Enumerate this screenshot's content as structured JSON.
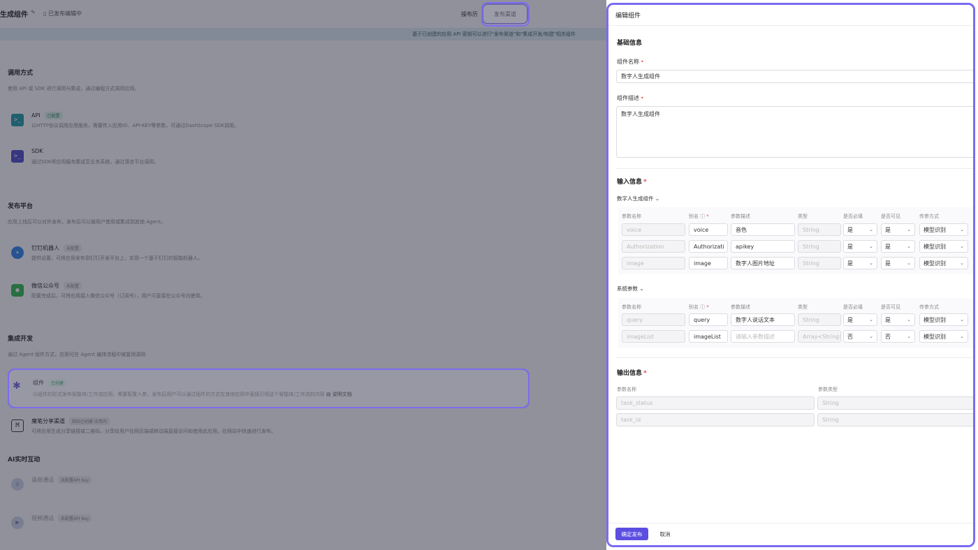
{
  "header": {
    "app_title": "生成组件",
    "publish_state": "已发布编辑中",
    "history_label": "操布历",
    "publish_channel_button": "发布渠道"
  },
  "banner": {
    "text": "基于已创建的应用 API 密钥可以进行\"发布渠道\"和\"集成开发/构建\"相关组件"
  },
  "sections": {
    "invoke": {
      "title": "调用方式",
      "desc": "使用 API 或 SDK 进行调用与集成，通过编程方式调用应用。",
      "items": [
        {
          "name": "API",
          "tag": "已配置",
          "desc": "以HTTP协议调用应用服务，需要传入应用ID、API-KEY等参数，可通过DashScope SDK调用。"
        },
        {
          "name": "SDK",
          "tag": "",
          "desc": "通过SDK将应用服务集成至业务系统，通过语言平台调用。"
        }
      ]
    },
    "platform": {
      "title": "发布平台",
      "desc": "应用上线后可以对外发布，发布后可以被用户使用或集成到其他 Agent。",
      "items": [
        {
          "name": "钉钉机器人",
          "tag": "未配置",
          "desc": "提供设置，可将应用发布到钉钉开发平台上，实现一个基于钉钉的智能机器人。"
        },
        {
          "name": "微信公众号",
          "tag": "未配置",
          "desc": "配置完成后，可将应用接入微信公众号（订阅号），用户可直接在公众号内使用。"
        }
      ]
    },
    "integration": {
      "title": "集成开发",
      "desc": "通过 Agent 组件方式，应用可在 Agent 编排流程中被复用调用",
      "component": {
        "name": "组件",
        "tag": "已创建",
        "desc": "以组件的形式发布智能体/工作流应用，需要配置入参，发布后用户可以通过组件的方式在其他应用中直接引用这个智能体/工作流的内容",
        "doc_link": "说明文档"
      },
      "mobile": {
        "name": "魔笔分享渠道",
        "tag": "网站已创建 应用内",
        "desc": "可将应用生成分享链接或二维码，分享给用户在网页端或移动端直接访问和使用此应用，在网站中快速进行发布。"
      }
    },
    "realtime": {
      "title": "AI实时互动",
      "items": [
        {
          "name": "语音通话",
          "tag": "未配置API Key"
        },
        {
          "name": "视频通话",
          "tag": "未配置API Key"
        }
      ]
    }
  },
  "drawer": {
    "title": "编辑组件",
    "basic_title": "基础信息",
    "name_label": "组件名称",
    "name_value": "数字人生成组件",
    "desc_label": "组件描述",
    "desc_value": "数字人生成组件",
    "input_title": "输入信息",
    "group1_label": "数字人生成组件",
    "group2_label": "系统参数",
    "headers": [
      "参数名称",
      "别名",
      "参数描述",
      "类型",
      "是否必填",
      "是否可见",
      "传参方式"
    ],
    "group1_rows": [
      {
        "param": "voice",
        "alias": "voice",
        "desc": "音色",
        "type": "String",
        "required": "是",
        "visible": "是",
        "mode": "模型识别"
      },
      {
        "param": "Authorization",
        "alias": "Authorizati",
        "desc": "apikey",
        "type": "String",
        "required": "是",
        "visible": "是",
        "mode": "模型识别"
      },
      {
        "param": "image",
        "alias": "image",
        "desc": "数字人图片地址",
        "type": "String",
        "required": "是",
        "visible": "是",
        "mode": "模型识别"
      }
    ],
    "group2_rows": [
      {
        "param": "query",
        "alias": "query",
        "desc": "数字人说话文本",
        "type": "String",
        "required": "是",
        "visible": "是",
        "mode": "模型识别"
      },
      {
        "param": "imageList",
        "alias": "imageList",
        "desc": "",
        "desc_placeholder": "请输入参数描述",
        "type": "Array<String>",
        "required": "否",
        "visible": "否",
        "mode": "模型识别"
      }
    ],
    "output_title": "输出信息",
    "output_headers": [
      "参数名称",
      "参数类型"
    ],
    "output_rows": [
      {
        "param": "task_status",
        "type": "String"
      },
      {
        "param": "task_id",
        "type": "String"
      }
    ],
    "confirm_button": "确定发布",
    "cancel_button": "取消"
  }
}
